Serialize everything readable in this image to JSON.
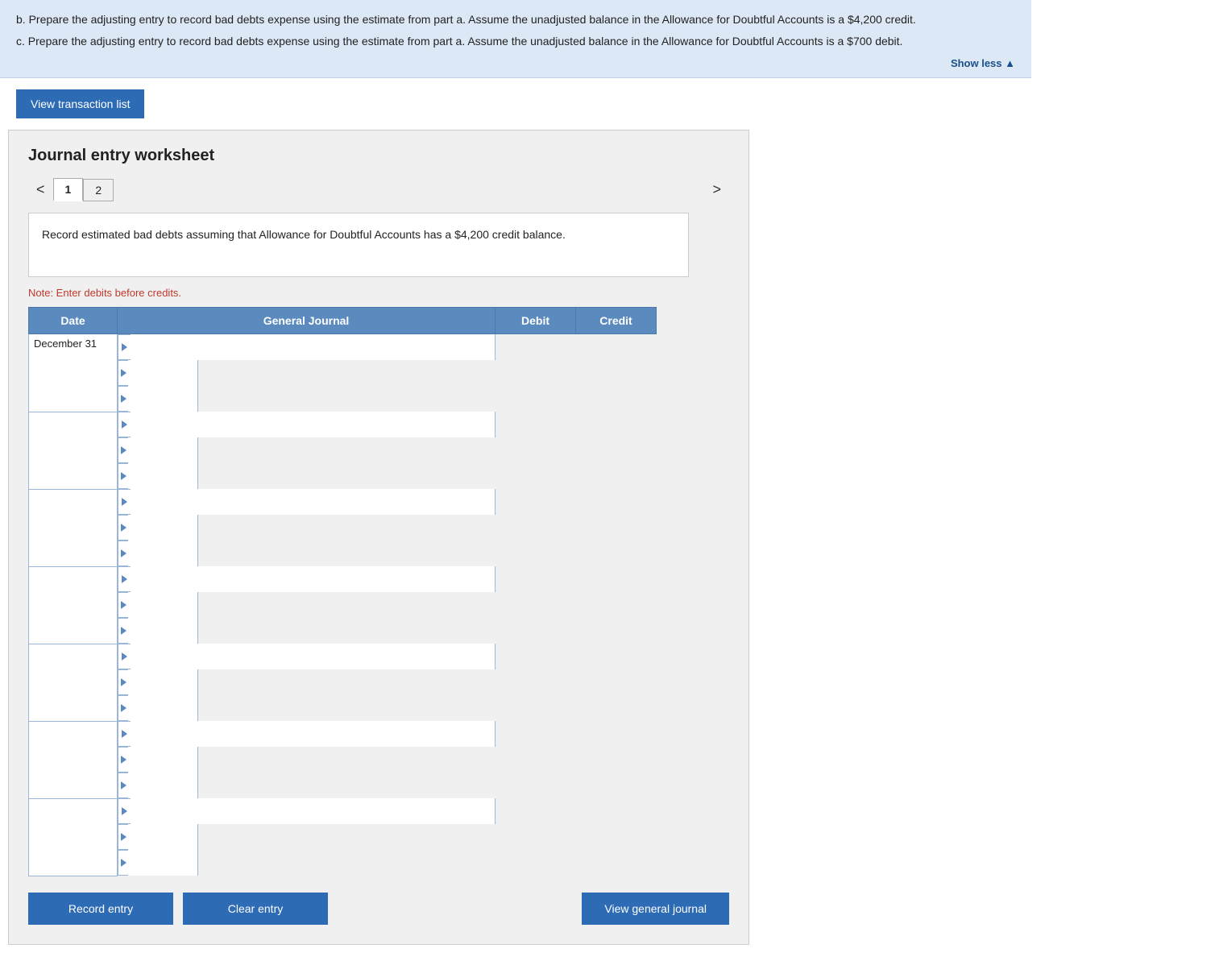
{
  "topInfo": {
    "partB": "b. Prepare the adjusting entry to record bad debts expense using the estimate from part a. Assume the unadjusted balance in the Allowance for Doubtful Accounts is a $4,200 credit.",
    "partC": "c. Prepare the adjusting entry to record bad debts expense using the estimate from part a. Assume the unadjusted balance in the Allowance for Doubtful Accounts is a $700 debit.",
    "showLessLabel": "Show less ▲"
  },
  "viewTransactionBtn": "View transaction list",
  "worksheet": {
    "title": "Journal entry worksheet",
    "tabs": [
      {
        "label": "1",
        "active": true
      },
      {
        "label": "2",
        "active": false
      }
    ],
    "prevArrow": "<",
    "nextArrow": ">",
    "instruction": "Record estimated bad debts assuming that Allowance for Doubtful Accounts has a $4,200 credit balance.",
    "note": "Note: Enter debits before credits.",
    "table": {
      "headers": [
        "Date",
        "General Journal",
        "Debit",
        "Credit"
      ],
      "rows": [
        {
          "date": "December 31",
          "journal": "",
          "debit": "",
          "credit": ""
        },
        {
          "date": "",
          "journal": "",
          "debit": "",
          "credit": ""
        },
        {
          "date": "",
          "journal": "",
          "debit": "",
          "credit": ""
        },
        {
          "date": "",
          "journal": "",
          "debit": "",
          "credit": ""
        },
        {
          "date": "",
          "journal": "",
          "debit": "",
          "credit": ""
        },
        {
          "date": "",
          "journal": "",
          "debit": "",
          "credit": ""
        },
        {
          "date": "",
          "journal": "",
          "debit": "",
          "credit": ""
        }
      ]
    },
    "buttons": {
      "recordEntry": "Record entry",
      "clearEntry": "Clear entry",
      "viewGeneralJournal": "View general journal"
    }
  }
}
